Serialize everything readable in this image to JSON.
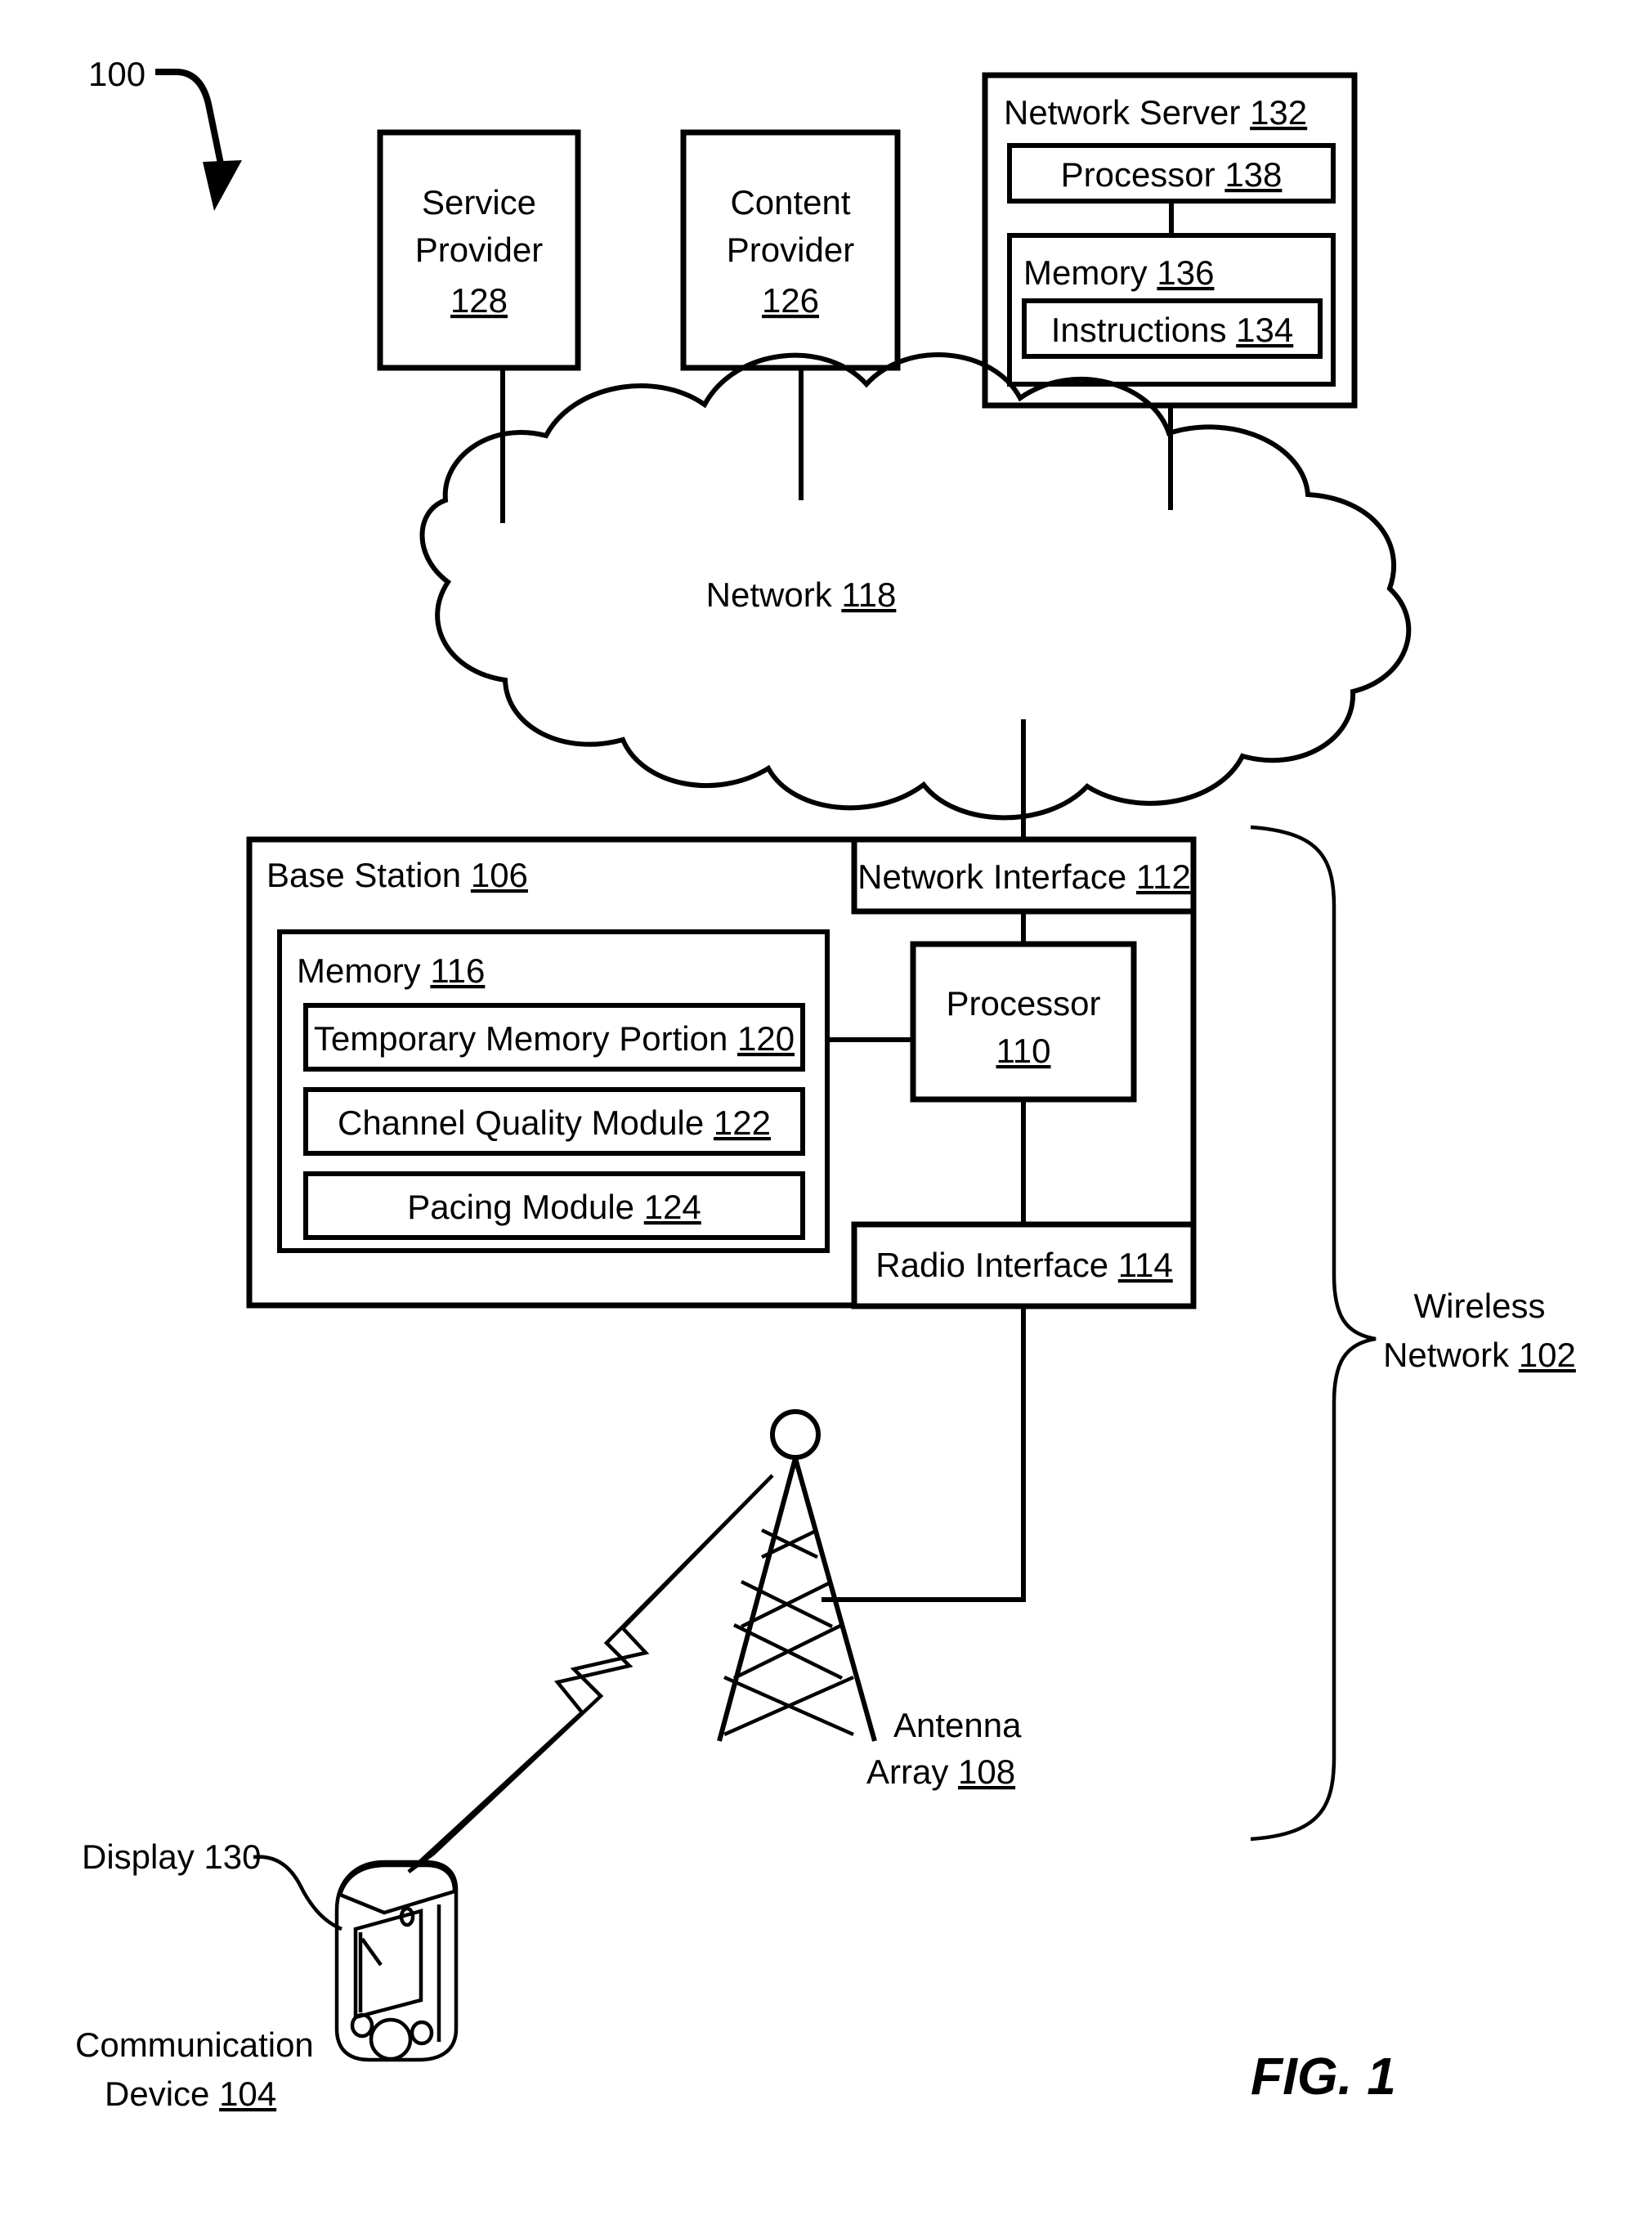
{
  "figure": {
    "label": "FIG. 1",
    "system_ref": "100"
  },
  "nodes": {
    "service_provider": {
      "line1": "Service",
      "line2": "Provider",
      "ref": "128"
    },
    "content_provider": {
      "line1": "Content",
      "line2": "Provider",
      "ref": "126"
    },
    "network_server": {
      "label": "Network Server",
      "ref": "132",
      "processor": {
        "label": "Processor",
        "ref": "138"
      },
      "memory": {
        "label": "Memory",
        "ref": "136"
      },
      "instructions": {
        "label": "Instructions",
        "ref": "134"
      }
    },
    "network_cloud": {
      "label": "Network",
      "ref": "118"
    },
    "base_station": {
      "label": "Base Station",
      "ref": "106",
      "network_interface": {
        "label": "Network Interface",
        "ref": "112"
      },
      "radio_interface": {
        "label": "Radio Interface",
        "ref": "114"
      },
      "processor": {
        "label": "Processor",
        "ref": "110"
      },
      "memory": {
        "label": "Memory",
        "ref": "116"
      },
      "modules": [
        {
          "label": "Temporary Memory Portion",
          "ref": "120"
        },
        {
          "label": "Channel Quality Module",
          "ref": "122"
        },
        {
          "label": "Pacing Module",
          "ref": "124"
        }
      ]
    },
    "antenna_array": {
      "line1": "Antenna",
      "line2": "Array",
      "ref": "108"
    },
    "wireless_network": {
      "line1": "Wireless",
      "line2": "Network",
      "ref": "102"
    },
    "communication_device": {
      "line1": "Communication",
      "line2": "Device",
      "ref": "104"
    },
    "display": {
      "label": "Display 130"
    }
  },
  "colors": {
    "ink": "#000000",
    "paper": "#ffffff"
  }
}
